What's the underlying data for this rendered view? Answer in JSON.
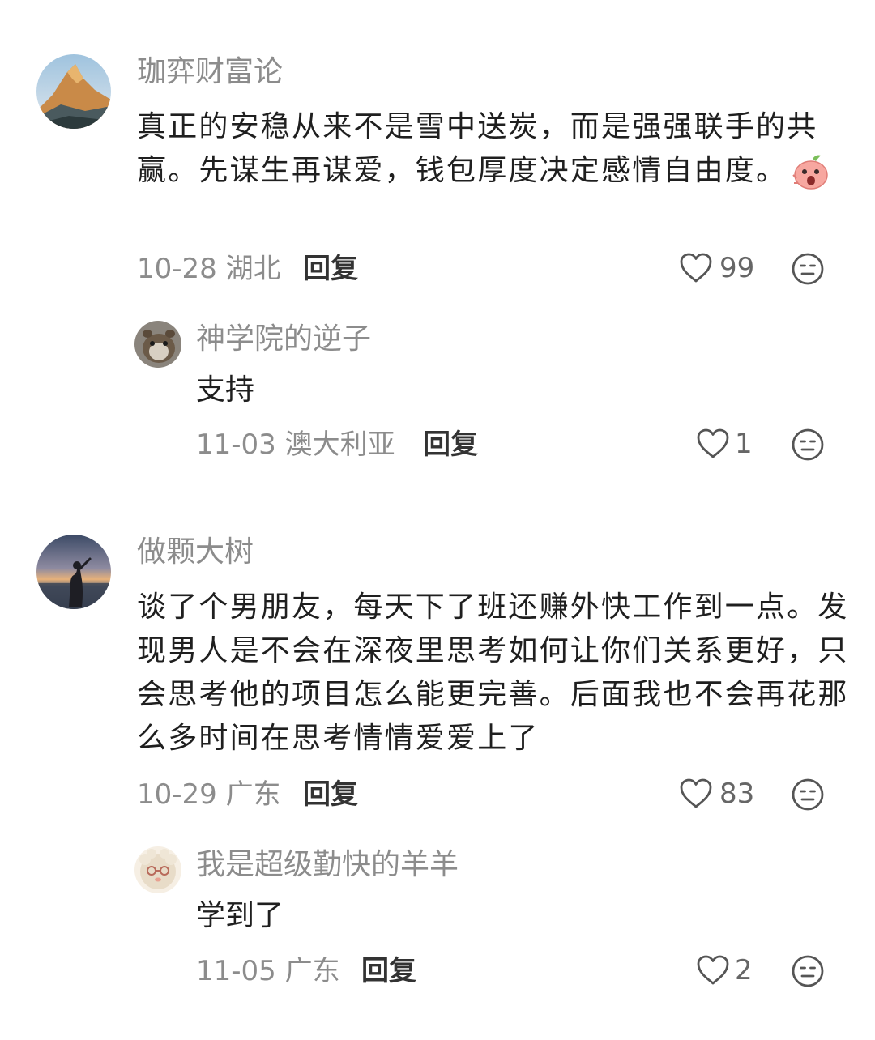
{
  "comments": [
    {
      "username": "珈弈财富论",
      "text": "真正的安稳从来不是雪中送炭，而是强强联手的共赢。先谋生再谋爱，钱包厚度决定感情自由度。",
      "date": "10-28",
      "location": "湖北",
      "reply_label": "回复",
      "likes": "99",
      "replies": [
        {
          "username": "神学院的逆子",
          "text": "支持",
          "date": "11-03",
          "location": "澳大利亚",
          "reply_label": "回复",
          "likes": "1"
        }
      ]
    },
    {
      "username": "做颗大树",
      "text": "谈了个男朋友，每天下了班还赚外快工作到一点。发现男人是不会在深夜里思考如何让你们关系更好，只会思考他的项目怎么能更完善。后面我也不会再花那么多时间在思考情情爱爱上了",
      "date": "10-29",
      "location": "广东",
      "reply_label": "回复",
      "likes": "83",
      "replies": [
        {
          "username": "我是超级勤快的羊羊",
          "text": "学到了",
          "date": "11-05",
          "location": "广东",
          "reply_label": "回复",
          "likes": "2"
        }
      ]
    }
  ],
  "icons": {
    "like": "heart-outline-icon",
    "dislike": "meh-face-icon",
    "sticker": "surprised-peach-sticker"
  }
}
